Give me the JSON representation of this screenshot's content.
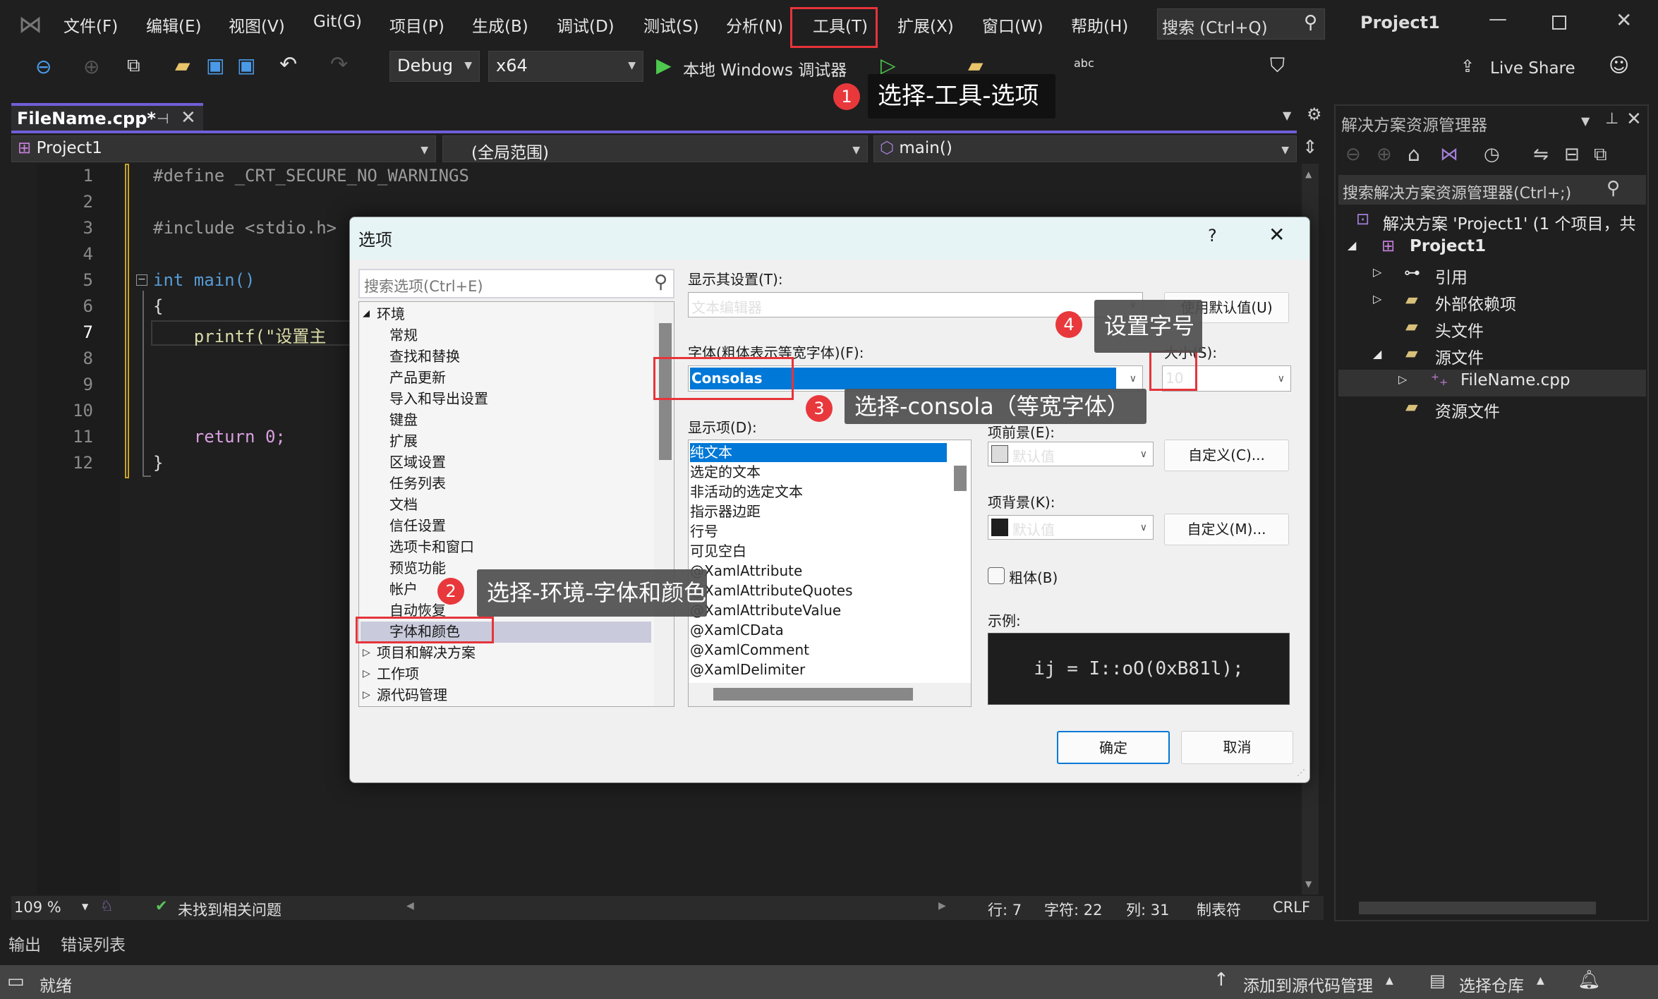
{
  "menu": {
    "items": [
      "文件(F)",
      "编辑(E)",
      "视图(V)",
      "Git(G)",
      "项目(P)",
      "生成(B)",
      "调试(D)",
      "测试(S)",
      "分析(N)",
      "工具(T)",
      "扩展(X)",
      "窗口(W)",
      "帮助(H)"
    ],
    "search_placeholder": "搜索 (Ctrl+Q)",
    "project_title": "Project1"
  },
  "toolbar": {
    "config": "Debug",
    "platform": "x64",
    "run_label": "本地 Windows 调试器",
    "live_share": "Live Share"
  },
  "editor": {
    "tab": "FileName.cpp*",
    "nav_project": "Project1",
    "nav_scope": "(全局范围)",
    "nav_member": "main()",
    "lines": [
      {
        "n": "1",
        "text": "#define _CRT_SECURE_NO_WARNINGS"
      },
      {
        "n": "2",
        "text": ""
      },
      {
        "n": "3",
        "text": "#include <stdio.h>"
      },
      {
        "n": "4",
        "text": ""
      },
      {
        "n": "5",
        "text": "int main()"
      },
      {
        "n": "6",
        "text": "{"
      },
      {
        "n": "7",
        "text": "    printf(\"设置主"
      },
      {
        "n": "8",
        "text": ""
      },
      {
        "n": "9",
        "text": ""
      },
      {
        "n": "10",
        "text": ""
      },
      {
        "n": "11",
        "text": "    return 0;"
      },
      {
        "n": "12",
        "text": "}"
      }
    ],
    "status": {
      "zoom": "109 %",
      "issues": "未找到相关问题",
      "line": "行: 7",
      "char": "字符: 22",
      "col": "列: 31",
      "tabs": "制表符",
      "eol": "CRLF"
    }
  },
  "bottom_tabs": [
    "输出",
    "错误列表"
  ],
  "statusbar": {
    "ready": "就绪",
    "add_source": "添加到源代码管理",
    "select_repo": "选择仓库"
  },
  "solution_explorer": {
    "title": "解决方案资源管理器",
    "search_placeholder": "搜索解决方案资源管理器(Ctrl+;)",
    "items": [
      "解决方案 'Project1' (1 个项目，共",
      "Project1",
      "引用",
      "外部依赖项",
      "头文件",
      "源文件",
      "FileName.cpp",
      "资源文件"
    ]
  },
  "dialog": {
    "title": "选项",
    "help": "?",
    "search_placeholder": "搜索选项(Ctrl+E)",
    "tree": {
      "root": "环境",
      "children": [
        "常规",
        "查找和替换",
        "产品更新",
        "导入和导出设置",
        "键盘",
        "扩展",
        "区域设置",
        "任务列表",
        "文档",
        "信任设置",
        "选项卡和窗口",
        "预览功能",
        "帐户",
        "自动恢复",
        "字体和颜色"
      ],
      "selected": "字体和颜色",
      "collapsed": [
        "项目和解决方案",
        "工作项",
        "源代码管理"
      ]
    },
    "show_settings_for_label": "显示其设置(T):",
    "show_settings_for_value": "文本编辑器",
    "use_defaults": "使用默认值(U)",
    "font_label": "字体(粗体表示等宽字体)(F):",
    "font_value": "Consolas",
    "size_label": "大小(S):",
    "size_value": "10",
    "display_items_label": "显示项(D):",
    "display_items": [
      "纯文本",
      "选定的文本",
      "非活动的选定文本",
      "指示器边距",
      "行号",
      "可见空白",
      "@XamlAttribute",
      "@XamlAttributeQuotes",
      "@XamlAttributeValue",
      "@XamlCData",
      "@XamlComment",
      "@XamlDelimiter"
    ],
    "display_selected": "纯文本",
    "fg_label": "项前景(E):",
    "fg_value": "默认值",
    "fg_custom": "自定义(C)...",
    "bg_label": "项背景(K):",
    "bg_value": "默认值",
    "bg_custom": "自定义(M)...",
    "bold_label": "粗体(B)",
    "bold_checked": false,
    "sample_label": "示例:",
    "sample_text": "ij = I::oO(0xB81l);",
    "ok": "确定",
    "cancel": "取消"
  },
  "annotations": [
    {
      "n": "1",
      "text": "选择-工具-选项"
    },
    {
      "n": "2",
      "text": "选择-环境-字体和颜色"
    },
    {
      "n": "3",
      "text": "选择-consola（等宽字体）"
    },
    {
      "n": "4",
      "text": "设置字号"
    }
  ],
  "colors": {
    "accent": "#0078d7",
    "tab_accent": "#6f5fd8",
    "annotation_red": "#e8383c",
    "editor_bg": "#1f1f1f"
  }
}
